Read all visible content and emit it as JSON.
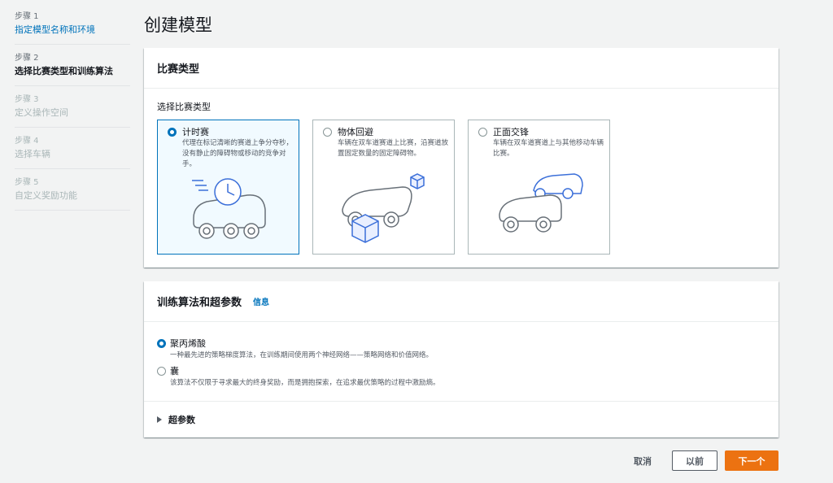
{
  "sidebar": {
    "steps": [
      {
        "num": "步骤 1",
        "label": "指定模型名称和环境"
      },
      {
        "num": "步骤 2",
        "label": "选择比赛类型和训练算法"
      },
      {
        "num": "步骤 3",
        "label": "定义操作空间"
      },
      {
        "num": "步骤 4",
        "label": "选择车辆"
      },
      {
        "num": "步骤 5",
        "label": "自定义奖励功能"
      }
    ]
  },
  "page_title": "创建模型",
  "race": {
    "title": "比赛类型",
    "field_label": "选择比赛类型",
    "options": [
      {
        "label": "计时赛",
        "desc": "代理在标记清晰的赛道上争分夺秒，没有静止的障碍物或移动的竞争对手。"
      },
      {
        "label": "物体回避",
        "desc": "车辆在双车道赛道上比赛，沿赛道放置固定数量的固定障碍物。"
      },
      {
        "label": "正面交锋",
        "desc": "车辆在双车道赛道上与其他移动车辆比赛。"
      }
    ]
  },
  "algo": {
    "title": "训练算法和超参数",
    "info": "信息",
    "options": [
      {
        "label": "聚丙烯酸",
        "desc": "一种最先进的策略梯度算法，在训练期间使用两个神经网络——策略网络和价值网络。"
      },
      {
        "label": "囊",
        "desc": "该算法不仅限于寻求最大的终身奖励，而是拥抱探索，在追求最优策略的过程中激励熵。"
      }
    ],
    "hyper": "超参数"
  },
  "buttons": {
    "cancel": "取消",
    "prev": "以前",
    "next": "下一个"
  },
  "colors": {
    "accent": "#0073bb",
    "primary": "#ec7211"
  }
}
